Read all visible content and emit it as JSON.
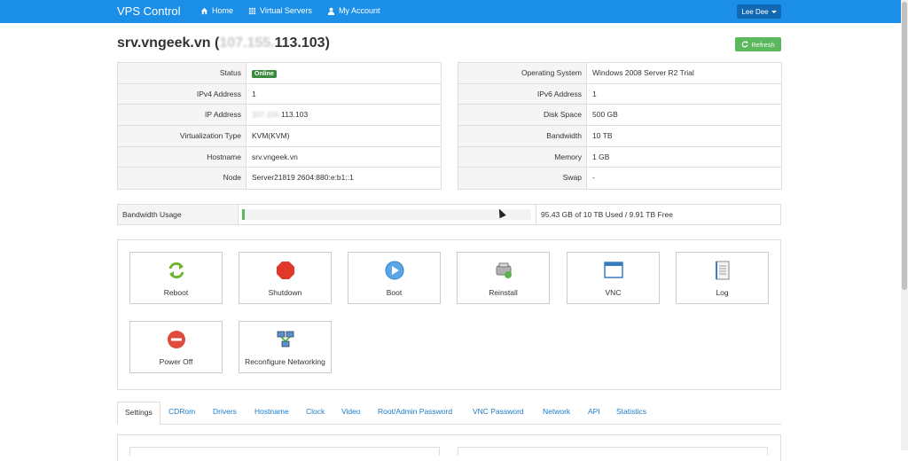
{
  "navbar": {
    "brand": "VPS Control",
    "items": [
      {
        "label": "Home",
        "icon": "home-icon"
      },
      {
        "label": "Virtual Servers",
        "icon": "grid-icon"
      },
      {
        "label": "My Account",
        "icon": "user-icon"
      }
    ],
    "user_menu": "Lee Dee"
  },
  "page": {
    "hostname": "srv.vngeek.vn",
    "ip_hidden": "107.155.",
    "ip_visible": "113.103",
    "title_open": "(",
    "title_close": ")",
    "refresh_label": "Refresh"
  },
  "info_left": [
    {
      "label": "Status",
      "value": "Online",
      "badge": true
    },
    {
      "label": "IPv4 Address",
      "value": "1"
    },
    {
      "label": "IP Address",
      "value_hidden": "107.155.",
      "value": "113.103"
    },
    {
      "label": "Virtualization Type",
      "value": "KVM(KVM)"
    },
    {
      "label": "Hostname",
      "value": "srv.vngeek.vn"
    },
    {
      "label": "Node",
      "value": "Server21819 2604:880:e:b1::1"
    }
  ],
  "info_right": [
    {
      "label": "Operating System",
      "value": "Windows 2008 Server R2 Trial"
    },
    {
      "label": "IPv6 Address",
      "value": "1"
    },
    {
      "label": "Disk Space",
      "value": "500 GB"
    },
    {
      "label": "Bandwidth",
      "value": "10 TB"
    },
    {
      "label": "Memory",
      "value": "1 GB"
    },
    {
      "label": "Swap",
      "value": "-"
    }
  ],
  "bandwidth": {
    "label": "Bandwidth Usage",
    "used_fraction": 0.0093,
    "text": "95.43 GB of 10 TB Used / 9.91 TB Free"
  },
  "actions": [
    {
      "label": "Reboot",
      "icon": "reboot-icon"
    },
    {
      "label": "Shutdown",
      "icon": "shutdown-icon"
    },
    {
      "label": "Boot",
      "icon": "boot-icon"
    },
    {
      "label": "Reinstall",
      "icon": "reinstall-icon"
    },
    {
      "label": "VNC",
      "icon": "vnc-icon"
    },
    {
      "label": "Log",
      "icon": "log-icon"
    },
    {
      "label": "Power Off",
      "icon": "power-off-icon"
    },
    {
      "label": "Reconfigure Networking",
      "icon": "network-icon"
    }
  ],
  "tabs": [
    "Settings",
    "CDRom",
    "Drivers",
    "Hostname",
    "Clock",
    "Video",
    "Root/Admin Password",
    "VNC Password",
    "Network",
    "API",
    "Statistics"
  ],
  "colors": {
    "navbar": "#1b8fe8",
    "success": "#5cb85c",
    "link": "#1a7bc9",
    "danger": "#e74c3c"
  }
}
